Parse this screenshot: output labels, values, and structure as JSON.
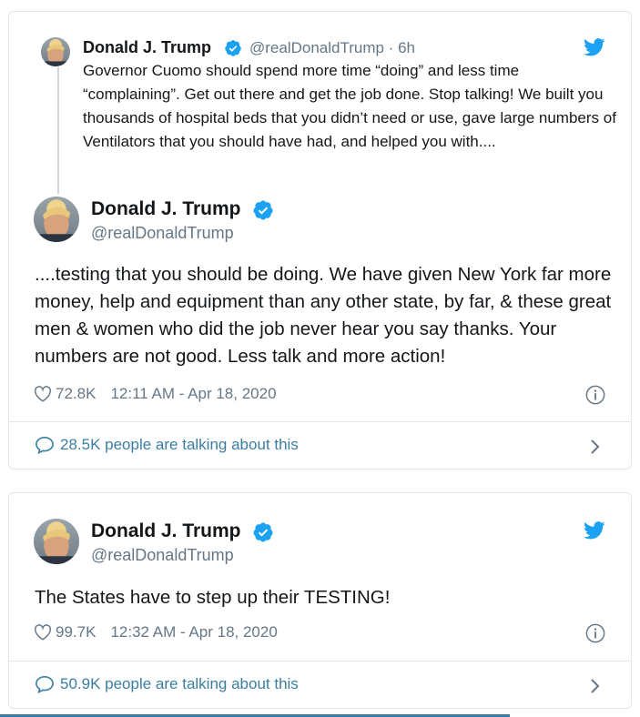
{
  "tweet1": {
    "quoted": {
      "name": "Donald J. Trump",
      "handle": "@realDonaldTrump · 6h",
      "text": "Governor Cuomo should spend more time “doing” and less time “complaining”. Get out there and get the job done. Stop talking! We built you thousands of hospital beds that you didn’t need or use, gave large numbers of Ventilators that you should have had, and helped you with...."
    },
    "name": "Donald J. Trump",
    "handle": "@realDonaldTrump",
    "text": "....testing that you should be doing. We have given New York far more money, help and equipment than any other state, by far, & these great men & women who did the job never hear you say thanks. Your numbers are not good. Less talk and more action!",
    "likes": "72.8K",
    "time": "12:11 AM - Apr 18, 2020",
    "talking": "28.5K people are talking about this"
  },
  "tweet2": {
    "name": "Donald J. Trump",
    "handle": "@realDonaldTrump",
    "text": "The States have to step up their TESTING!",
    "likes": "99.7K",
    "time": "12:32 AM - Apr 18, 2020",
    "talking": "50.9K people are talking about this"
  },
  "colors": {
    "twitter_blue": "#1da1f2",
    "verified_blue": "#1da1f2",
    "link_blue": "#3b7ea1",
    "muted_gray": "#657786",
    "border": "#e1e8ed"
  },
  "icons": [
    "twitter-bird-icon",
    "verified-badge-icon",
    "heart-icon",
    "info-icon",
    "comment-bubble-icon",
    "chevron-right-icon"
  ]
}
